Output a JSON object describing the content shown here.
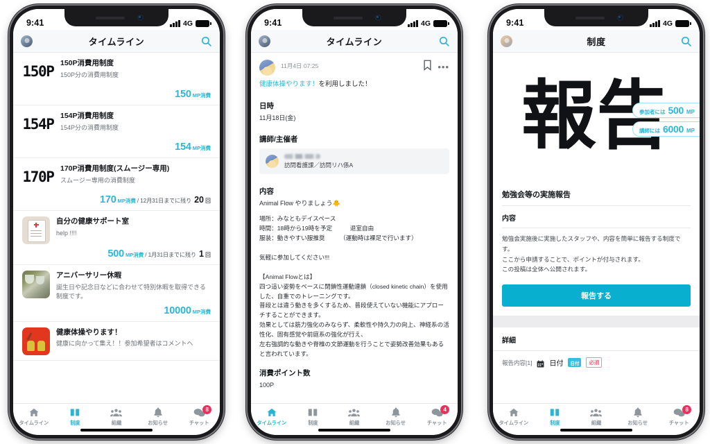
{
  "statusbar": {
    "time": "9:41",
    "network": "4G"
  },
  "phone1": {
    "appbar": {
      "title": "タイムライン",
      "avatar": "user-avatar",
      "search": "search-icon"
    },
    "items": [
      {
        "badge_text": "150P",
        "thumb": "text",
        "title": "150P消費用制度",
        "desc": "150P分の消費用制度",
        "mp": "150",
        "mp_unit": "MP消費",
        "limit": "",
        "count": "",
        "count_unit": ""
      },
      {
        "badge_text": "154P",
        "thumb": "text",
        "title": "154P消費用制度",
        "desc": "154P分の消費用制度",
        "mp": "154",
        "mp_unit": "MP消費",
        "limit": "",
        "count": "",
        "count_unit": ""
      },
      {
        "badge_text": "170P",
        "thumb": "text",
        "title": "170P消費用制度(スムージー専用)",
        "desc": "スムージー専用の消費制度",
        "mp": "170",
        "mp_unit": "MP消費",
        "limit": "/ 12月31日までに残り",
        "count": "20",
        "count_unit": "回"
      },
      {
        "badge_text": "",
        "thumb": "clipboard",
        "title": "自分の健康サポート室",
        "desc": "help !!!!",
        "mp": "500",
        "mp_unit": "MP消費",
        "limit": "/ 1月31日までに残り",
        "count": "1",
        "count_unit": "回"
      },
      {
        "badge_text": "",
        "thumb": "wine",
        "title": "アニバーサリー休暇",
        "desc": "誕生日や記念日などに合わせて特別休暇を取得できる制度です。",
        "mp": "10000",
        "mp_unit": "MP消費",
        "limit": "",
        "count": "",
        "count_unit": ""
      },
      {
        "badge_text": "",
        "thumb": "exercise",
        "title": "健康体操やります！",
        "desc": "健康に向かって集え！！参加希望者はコメントへ",
        "mp": "",
        "mp_unit": "",
        "limit": "",
        "count": "",
        "count_unit": ""
      }
    ],
    "tabs": [
      {
        "label": "タイムライン",
        "icon": "home-icon",
        "active": false,
        "badge": ""
      },
      {
        "label": "制度",
        "icon": "book-icon",
        "active": true,
        "badge": ""
      },
      {
        "label": "組織",
        "icon": "people-icon",
        "active": false,
        "badge": ""
      },
      {
        "label": "お知らせ",
        "icon": "bell-icon",
        "active": false,
        "badge": ""
      },
      {
        "label": "チャット",
        "icon": "chat-icon",
        "active": false,
        "badge": "8"
      }
    ]
  },
  "phone2": {
    "appbar": {
      "title": "タイムライン",
      "avatar": "user-avatar",
      "search": "search-icon"
    },
    "post": {
      "author_masked": "■■ ■",
      "date": "11月4日 07:25",
      "bookmark": "bookmark-icon",
      "more": "more-icon",
      "used_link": "健康体操やります！",
      "used_suffix": "を利用しました！",
      "sec_datetime_label": "日時",
      "sec_datetime_value": "11月18日(金)",
      "sec_host_label": "講師/主催者",
      "host_name_masked": "■■ ■",
      "host_dept": "訪問看護課／訪問リハ係A",
      "sec_content_label": "内容",
      "content_lead": "Animal Flow やりましょう🐥",
      "content_body": "場所：みなともデイスペース\n時間：18時から19時を予定　　　退室自由\n服装：動きやすい服推奨　　　（運動時は裸足で行います）\n\n気軽に参加してください!!!\n\n【Animal Flowとは】\n四つ這い姿勢をベースに閉鎖性運動連鎖（closed kinetic chain）を使用した、自重でのトレーニングです。\n普段とは違う動きを多くするため、普段使えていない機能にアプローチすることができます。\n効果としては筋力強化のみならず、柔軟性や持久力の向上、神経系の活性化、固有感覚や前庭系の強化が行え、\n左右強調的な動きや脊椎の文節運動を行うことで姿勢改善効果もあると言われています。",
      "sec_points_label": "消費ポイント数",
      "points_value": "100P"
    },
    "tabs": [
      {
        "label": "タイムライン",
        "icon": "home-icon",
        "active": true,
        "badge": ""
      },
      {
        "label": "制度",
        "icon": "book-icon",
        "active": false,
        "badge": ""
      },
      {
        "label": "組織",
        "icon": "people-icon",
        "active": false,
        "badge": ""
      },
      {
        "label": "お知らせ",
        "icon": "bell-icon",
        "active": false,
        "badge": ""
      },
      {
        "label": "チャット",
        "icon": "chat-icon",
        "active": false,
        "badge": "4"
      }
    ]
  },
  "phone3": {
    "appbar": {
      "title": "制度",
      "avatar": "user-avatar",
      "search": "search-icon"
    },
    "hero_char": "報告",
    "badges": [
      {
        "label": "参加者には",
        "value": "500",
        "unit": "MP"
      },
      {
        "label": "講師には",
        "value": "6000",
        "unit": "MP"
      }
    ],
    "heading": "勉強会等の実施報告",
    "content_label": "内容",
    "content_body": "勉強会実施後に実施したスタッフや、内容を簡単に報告する制度です。\nここから申請することで、ポイントが付与されます。\nこの投稿は全体へ公開されます。",
    "cta_label": "報告する",
    "detail_label": "詳細",
    "field": {
      "prefix": "報告内容[1]",
      "icon": "calendar-icon",
      "name": "日付",
      "pill": "日付",
      "required": "必須"
    },
    "tabs": [
      {
        "label": "タイムライン",
        "icon": "home-icon",
        "active": false,
        "badge": ""
      },
      {
        "label": "制度",
        "icon": "book-icon",
        "active": true,
        "badge": ""
      },
      {
        "label": "組織",
        "icon": "people-icon",
        "active": false,
        "badge": ""
      },
      {
        "label": "お知らせ",
        "icon": "bell-icon",
        "active": false,
        "badge": ""
      },
      {
        "label": "チャット",
        "icon": "chat-icon",
        "active": false,
        "badge": "8"
      }
    ]
  },
  "colors": {
    "accent": "#2bb6d6",
    "cta": "#08afce",
    "badge": "#e8315c",
    "text": "#14171b"
  }
}
